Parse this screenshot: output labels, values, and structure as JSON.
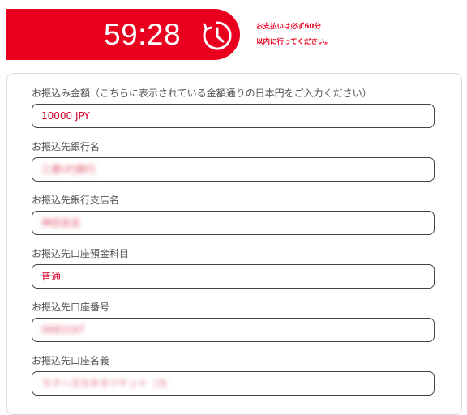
{
  "timer": {
    "value": "59:28",
    "icon": "stopwatch-icon"
  },
  "notice": {
    "line1": "お支払いは必ず60分",
    "line2": "以内に行ってください。"
  },
  "form": {
    "fields": [
      {
        "label": "お振込み金額（こちらに表示されている金額通りの日本円をご入力ください）",
        "value": "10000 JPY"
      },
      {
        "label": "お振込先銀行名",
        "value": "三菱UFJ銀行"
      },
      {
        "label": "お振込先銀行支店名",
        "value": "神田支店"
      },
      {
        "label": "お振込先口座預金科目",
        "value": "普通"
      },
      {
        "label": "お振込先口座番号",
        "value": "0683197"
      },
      {
        "label": "お振込先口座名義",
        "value": "ラクーズカネタツケット（カ"
      }
    ]
  },
  "colors": {
    "accent": "#e8001e",
    "text_value": "#d4002a",
    "label": "#555555",
    "panel_border": "#d9d9d9"
  }
}
